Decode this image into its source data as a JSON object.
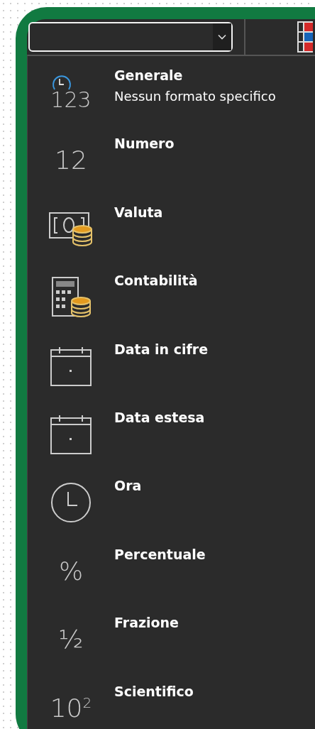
{
  "menu": [
    {
      "kind": "clock-digits",
      "glyph": "123",
      "label": "Generale",
      "description": "Nessun formato specifico"
    },
    {
      "kind": "digits",
      "glyph": "12",
      "label": "Numero"
    },
    {
      "kind": "money",
      "label": "Valuta"
    },
    {
      "kind": "calculator",
      "label": "Contabilità"
    },
    {
      "kind": "calendar",
      "label": "Data in cifre"
    },
    {
      "kind": "calendar",
      "label": "Data estesa"
    },
    {
      "kind": "clock",
      "label": "Ora"
    },
    {
      "kind": "digits",
      "glyph": "%",
      "label": "Percentuale"
    },
    {
      "kind": "digits",
      "glyph": "½",
      "label": "Frazione"
    },
    {
      "kind": "digits",
      "glyph": "10$^{2}$",
      "label": "Scientifico"
    }
  ]
}
